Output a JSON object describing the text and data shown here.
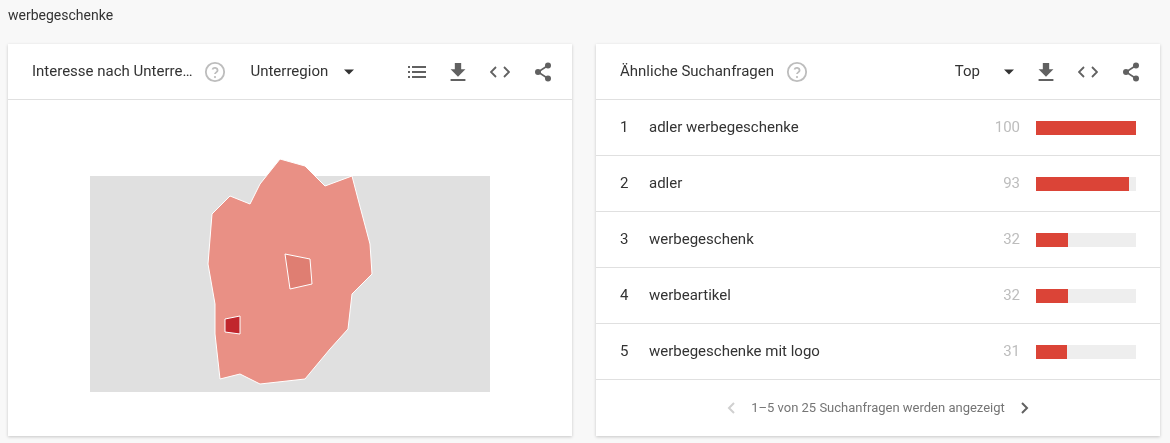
{
  "page_title": "werbegeschenke",
  "region_panel": {
    "title": "Interesse nach Unterre…",
    "resolution": "Unterregion"
  },
  "queries_panel": {
    "title": "Ähnliche Suchanfragen",
    "sort": "Top",
    "rows": [
      {
        "rank": "1",
        "query": "adler werbegeschenke",
        "value": "100",
        "level": 1.0
      },
      {
        "rank": "2",
        "query": "adler",
        "value": "93",
        "level": 0.93
      },
      {
        "rank": "3",
        "query": "werbegeschenk",
        "value": "32",
        "level": 0.32
      },
      {
        "rank": "4",
        "query": "werbeartikel",
        "value": "32",
        "level": 0.32
      },
      {
        "rank": "5",
        "query": "werbegeschenke mit logo",
        "value": "31",
        "level": 0.31
      }
    ],
    "pagination": {
      "text": "1–5 von 25 Suchanfragen werden angezeigt",
      "prev_disabled": true,
      "next_disabled": false
    }
  }
}
